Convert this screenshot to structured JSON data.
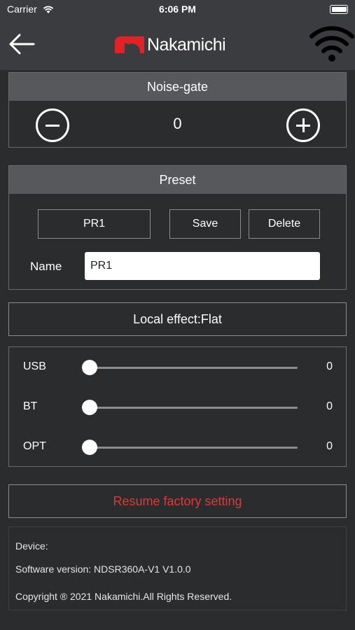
{
  "status_bar": {
    "carrier": "Carrier",
    "time": "6:06 PM"
  },
  "header": {
    "brand": "Nakamichi",
    "back_icon": "arrow-left-icon",
    "wifi_icon": "wifi-icon"
  },
  "noise_gate": {
    "title": "Noise-gate",
    "value": "0"
  },
  "preset": {
    "title": "Preset",
    "selected": "PR1",
    "save_label": "Save",
    "delete_label": "Delete",
    "name_label": "Name",
    "name_value": "PR1"
  },
  "local_effect": {
    "label": "Local effect:Flat"
  },
  "sliders": [
    {
      "label": "USB",
      "value": "0",
      "level": 0
    },
    {
      "label": "BT",
      "value": "0",
      "level": 0
    },
    {
      "label": "OPT",
      "value": "0",
      "level": 0
    }
  ],
  "resume": {
    "label": "Resume factory setting",
    "color": "#e2363b"
  },
  "device_info": {
    "device": "Device:",
    "software": "Software version: NDSR360A-V1 V1.0.0",
    "copyright": "Copyright ® 2021 Nakamichi.All Rights Reserved."
  },
  "colors": {
    "brand_red": "#e32227",
    "panel_header": "#57585b",
    "background": "#2b2c2e"
  }
}
